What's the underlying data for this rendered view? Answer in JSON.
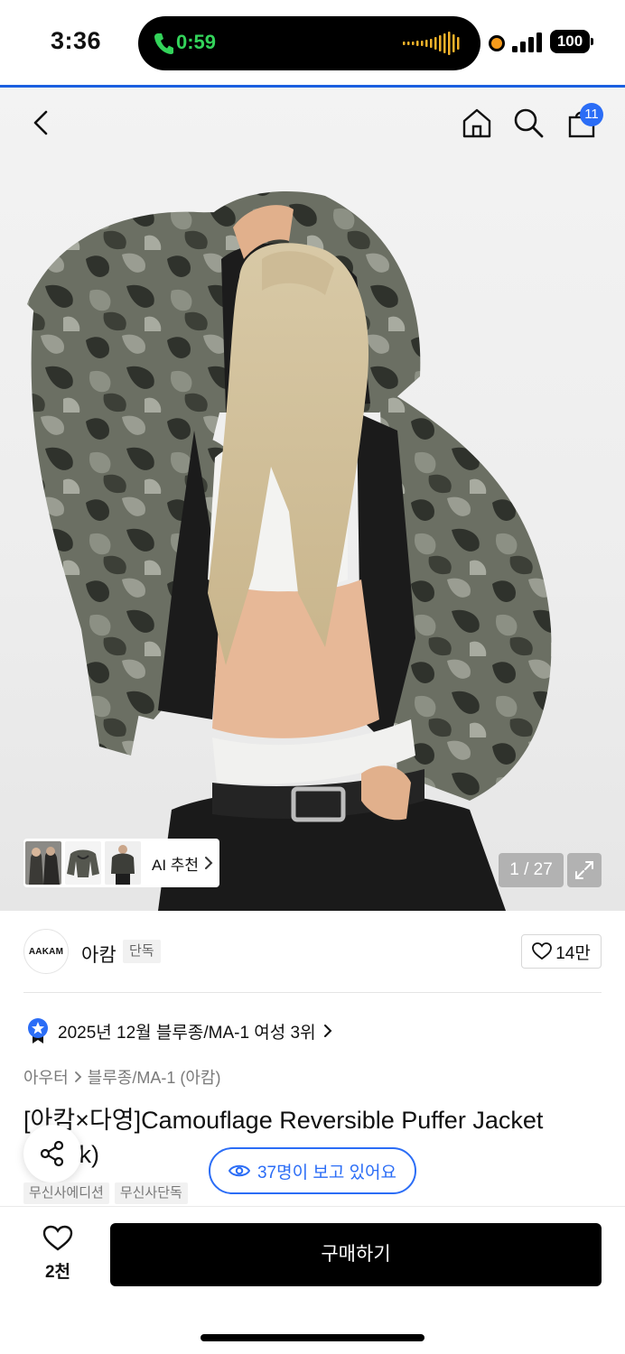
{
  "status_bar": {
    "time": "3:36",
    "call_duration": "0:59",
    "battery": "100",
    "icons": [
      "phone-icon",
      "waveform-icon",
      "privacy-dot-icon",
      "signal-icon",
      "battery-icon"
    ]
  },
  "nav": {
    "icons": [
      "back-arrow-icon",
      "home-icon",
      "search-icon",
      "shopping-bag-icon"
    ],
    "cart_count": "11"
  },
  "gallery": {
    "ai_label": "AI 추천",
    "counter": "1 / 27",
    "icons": [
      "chevron-right-icon",
      "expand-icon"
    ]
  },
  "brand": {
    "logo_text": "AAKAM",
    "name": "아캄",
    "tag": "단독",
    "like_count": "14만"
  },
  "ranking": {
    "text": "2025년 12월 블루종/MA-1 여성 3위",
    "icon": "star-medal-icon"
  },
  "breadcrumb": {
    "level1": "아우터",
    "level2": "블루종/MA-1 (아캄)"
  },
  "product": {
    "title": "[아캄×다영]Camouflage Reversible Puffer Jacket (Black)",
    "viewers": "37명이 보고 있어요",
    "tags": [
      "무신사에디션",
      "무신사단독"
    ]
  },
  "bottom": {
    "wish_count": "2천",
    "buy_label": "구매하기"
  },
  "colors": {
    "accent": "#2b6df6",
    "call_green": "#33d35a",
    "progress_line": "#1b5fe0",
    "buy_button": "#000000"
  }
}
